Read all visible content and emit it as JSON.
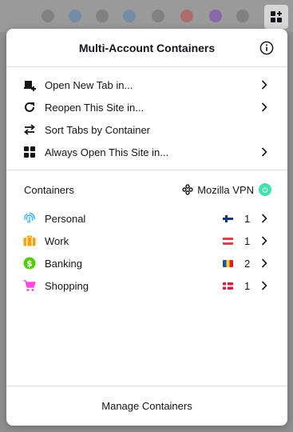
{
  "panel": {
    "title": "Multi-Account Containers",
    "info_icon": "info-icon"
  },
  "menu": [
    {
      "name": "open-new-tab-in",
      "label": "Open New Tab in...",
      "icon": "new-tab-icon",
      "has_chevron": true
    },
    {
      "name": "reopen-site-in",
      "label": "Reopen This Site in...",
      "icon": "reopen-icon",
      "has_chevron": true
    },
    {
      "name": "sort-tabs",
      "label": "Sort Tabs by Container",
      "icon": "sort-icon",
      "has_chevron": false
    },
    {
      "name": "always-open-site-in",
      "label": "Always Open This Site in...",
      "icon": "grid-icon",
      "has_chevron": true
    }
  ],
  "containers_section": {
    "heading": "Containers",
    "vpn_label": "Mozilla VPN",
    "vpn_status_color": "#3fe1b0"
  },
  "containers": [
    {
      "name": "personal",
      "label": "Personal",
      "icon": "fingerprint-icon",
      "color": "#37adff",
      "flag": "finland-flag",
      "count": "1"
    },
    {
      "name": "work",
      "label": "Work",
      "icon": "briefcase-icon",
      "color": "#ff9f00",
      "flag": "austria-flag",
      "count": "1"
    },
    {
      "name": "banking",
      "label": "Banking",
      "icon": "dollar-icon",
      "color": "#51cd00",
      "flag": "moldova-flag",
      "count": "2"
    },
    {
      "name": "shopping",
      "label": "Shopping",
      "icon": "cart-icon",
      "color": "#ff4bda",
      "flag": "denmark-flag",
      "count": "1"
    }
  ],
  "footer": {
    "label": "Manage Containers"
  }
}
